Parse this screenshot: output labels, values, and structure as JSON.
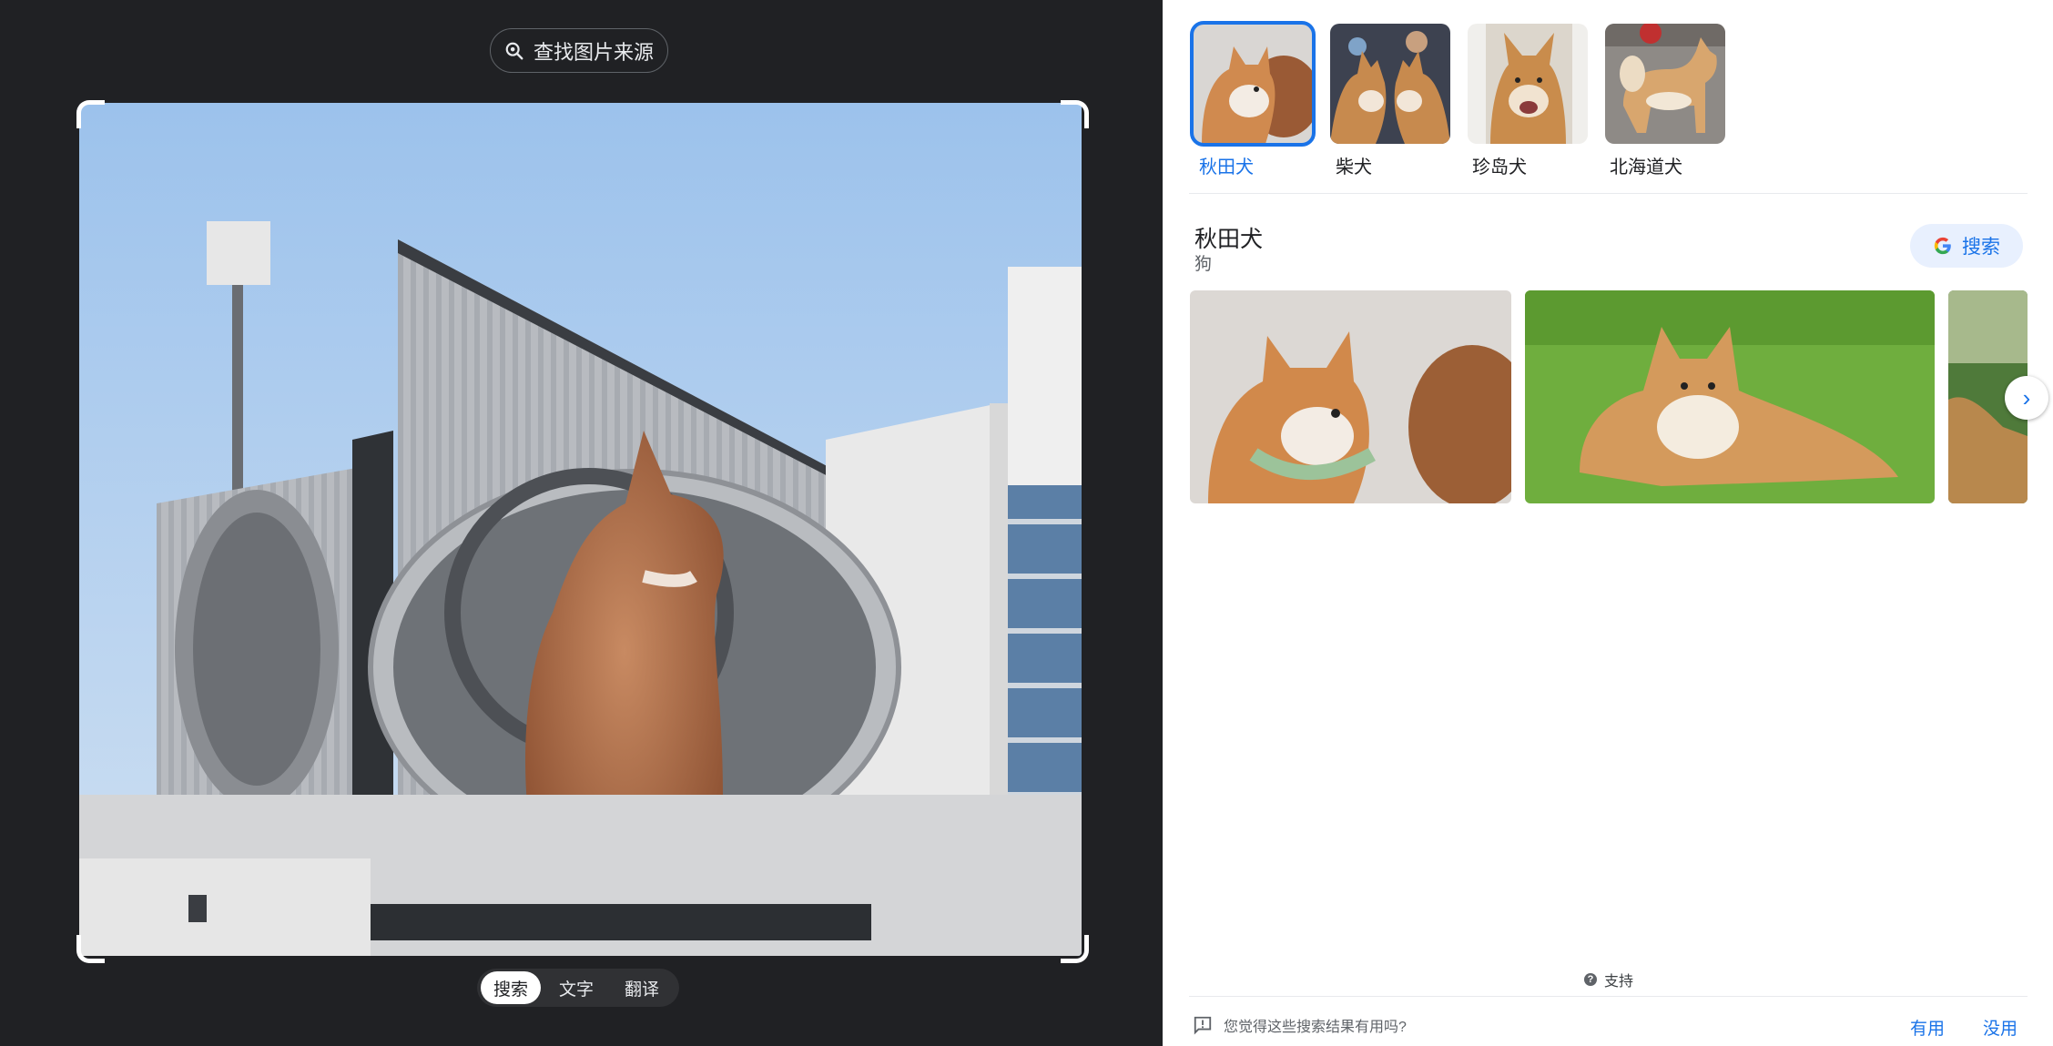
{
  "find_source": {
    "label": "查找图片来源",
    "icon": "lens-search-icon"
  },
  "mode_tabs": [
    {
      "label": "搜索",
      "active": true
    },
    {
      "label": "文字",
      "active": false
    },
    {
      "label": "翻译",
      "active": false
    }
  ],
  "breeds": [
    {
      "label": "秋田犬",
      "active": true
    },
    {
      "label": "柴犬",
      "active": false
    },
    {
      "label": "珍岛犬",
      "active": false
    },
    {
      "label": "北海道犬",
      "active": false
    }
  ],
  "entity": {
    "title": "秋田犬",
    "subtitle": "狗",
    "search_label": "搜索"
  },
  "footer": {
    "support": "支持",
    "question": "您觉得这些搜索结果有用吗?",
    "useful": "有用",
    "not_useful": "没用"
  },
  "colors": {
    "accent": "#1a73e8",
    "dark_bg": "#202124",
    "chip_bg": "#e8f0fe"
  }
}
